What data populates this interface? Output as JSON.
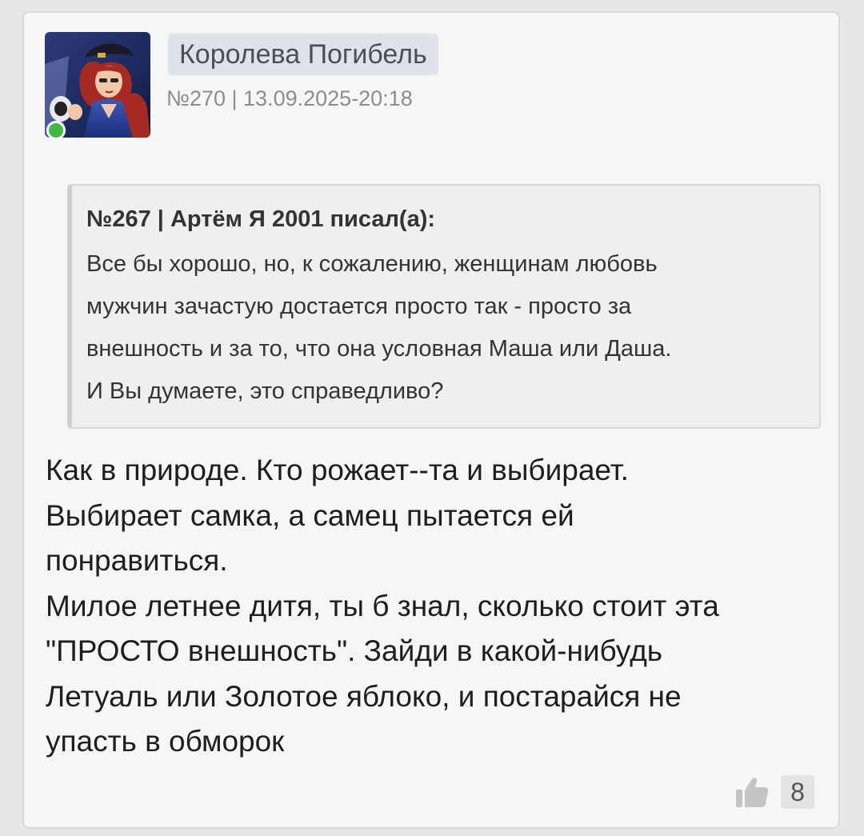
{
  "post": {
    "author": "Королева Погибель",
    "meta": "№270 | 13.09.2025-20:18",
    "avatar_icon": "user-avatar-image",
    "online_status_color": "#3dba3f"
  },
  "quote": {
    "header": "№267 | Артём Я 2001 писал(а):",
    "lines": [
      "Все бы хорошо, но, к сожалению, женщинам любовь",
      "мужчин зачастую достается просто так - просто за",
      "внешность и за то, что она условная Маша или Даша.",
      "И Вы думаете, это справедливо?"
    ]
  },
  "message": {
    "lines": [
      "Как в природе. Кто рожает--та и выбирает.",
      "Выбирает самка, а самец пытается ей",
      "понравиться.",
      "Милое летнее дитя, ты б знал, сколько стоит эта",
      "\"ПРОСТО внешность\". Зайди в какой-нибудь",
      "Летуаль или Золотое яблоко, и постарайся не",
      "упасть в обморок"
    ]
  },
  "likes": {
    "icon": "thumbs-up-icon",
    "count": "8"
  }
}
